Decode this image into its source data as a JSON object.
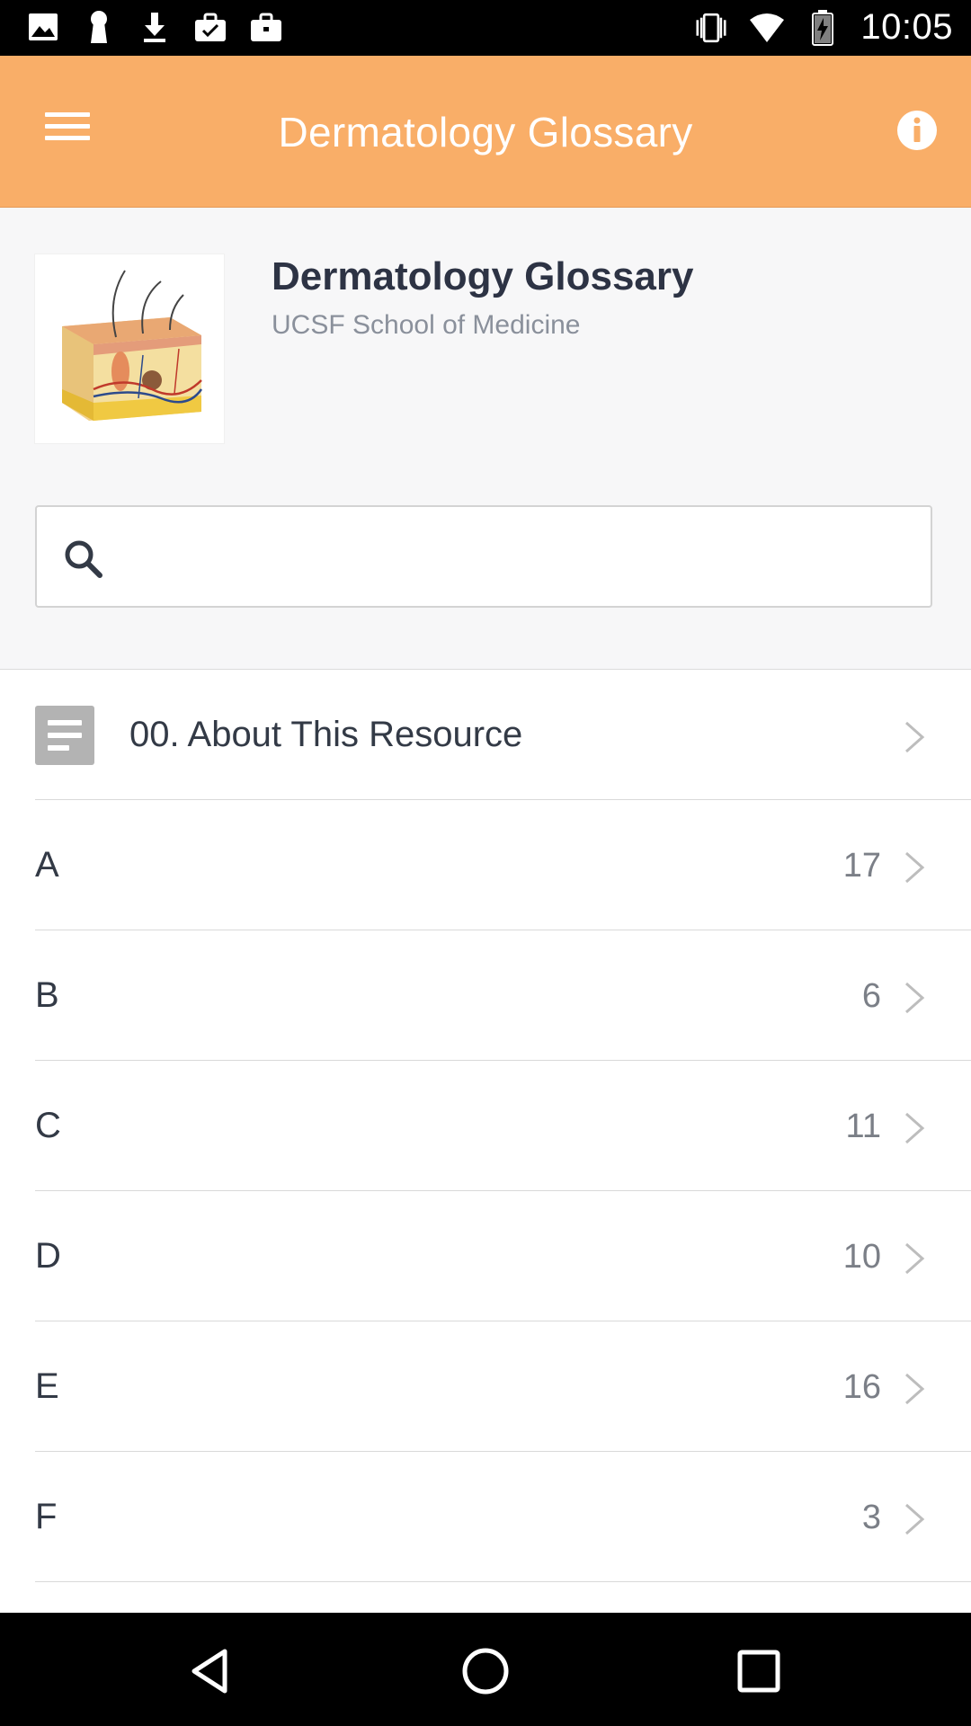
{
  "status_bar": {
    "time": "10:05",
    "left_icons": [
      "image-icon",
      "keyhole-icon",
      "download-icon",
      "briefcase-check-icon",
      "briefcase-icon"
    ],
    "right_icons": [
      "vibrate-icon",
      "wifi-icon",
      "battery-charging-icon"
    ]
  },
  "app_bar": {
    "title": "Dermatology Glossary",
    "color": "#f9ae68"
  },
  "header": {
    "title": "Dermatology Glossary",
    "subtitle": "UCSF School of Medicine",
    "image_icon": "skin-cross-section-image"
  },
  "search": {
    "placeholder": "",
    "value": ""
  },
  "list": [
    {
      "label": "00. About This Resource",
      "count": "",
      "icon": "document-icon"
    },
    {
      "label": "A",
      "count": "17"
    },
    {
      "label": "B",
      "count": "6"
    },
    {
      "label": "C",
      "count": "11"
    },
    {
      "label": "D",
      "count": "10"
    },
    {
      "label": "E",
      "count": "16"
    },
    {
      "label": "F",
      "count": "3"
    }
  ],
  "nav_bar": {
    "buttons": [
      "back-icon",
      "home-icon",
      "recents-icon"
    ]
  }
}
